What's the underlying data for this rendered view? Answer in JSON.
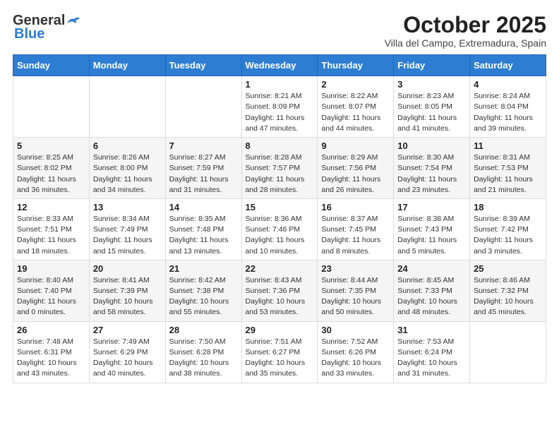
{
  "header": {
    "logo_general": "General",
    "logo_blue": "Blue",
    "month_title": "October 2025",
    "location": "Villa del Campo, Extremadura, Spain"
  },
  "weekdays": [
    "Sunday",
    "Monday",
    "Tuesday",
    "Wednesday",
    "Thursday",
    "Friday",
    "Saturday"
  ],
  "weeks": [
    [
      {
        "day": "",
        "info": ""
      },
      {
        "day": "",
        "info": ""
      },
      {
        "day": "",
        "info": ""
      },
      {
        "day": "1",
        "info": "Sunrise: 8:21 AM\nSunset: 8:09 PM\nDaylight: 11 hours\nand 47 minutes."
      },
      {
        "day": "2",
        "info": "Sunrise: 8:22 AM\nSunset: 8:07 PM\nDaylight: 11 hours\nand 44 minutes."
      },
      {
        "day": "3",
        "info": "Sunrise: 8:23 AM\nSunset: 8:05 PM\nDaylight: 11 hours\nand 41 minutes."
      },
      {
        "day": "4",
        "info": "Sunrise: 8:24 AM\nSunset: 8:04 PM\nDaylight: 11 hours\nand 39 minutes."
      }
    ],
    [
      {
        "day": "5",
        "info": "Sunrise: 8:25 AM\nSunset: 8:02 PM\nDaylight: 11 hours\nand 36 minutes."
      },
      {
        "day": "6",
        "info": "Sunrise: 8:26 AM\nSunset: 8:00 PM\nDaylight: 11 hours\nand 34 minutes."
      },
      {
        "day": "7",
        "info": "Sunrise: 8:27 AM\nSunset: 7:59 PM\nDaylight: 11 hours\nand 31 minutes."
      },
      {
        "day": "8",
        "info": "Sunrise: 8:28 AM\nSunset: 7:57 PM\nDaylight: 11 hours\nand 28 minutes."
      },
      {
        "day": "9",
        "info": "Sunrise: 8:29 AM\nSunset: 7:56 PM\nDaylight: 11 hours\nand 26 minutes."
      },
      {
        "day": "10",
        "info": "Sunrise: 8:30 AM\nSunset: 7:54 PM\nDaylight: 11 hours\nand 23 minutes."
      },
      {
        "day": "11",
        "info": "Sunrise: 8:31 AM\nSunset: 7:53 PM\nDaylight: 11 hours\nand 21 minutes."
      }
    ],
    [
      {
        "day": "12",
        "info": "Sunrise: 8:33 AM\nSunset: 7:51 PM\nDaylight: 11 hours\nand 18 minutes."
      },
      {
        "day": "13",
        "info": "Sunrise: 8:34 AM\nSunset: 7:49 PM\nDaylight: 11 hours\nand 15 minutes."
      },
      {
        "day": "14",
        "info": "Sunrise: 8:35 AM\nSunset: 7:48 PM\nDaylight: 11 hours\nand 13 minutes."
      },
      {
        "day": "15",
        "info": "Sunrise: 8:36 AM\nSunset: 7:46 PM\nDaylight: 11 hours\nand 10 minutes."
      },
      {
        "day": "16",
        "info": "Sunrise: 8:37 AM\nSunset: 7:45 PM\nDaylight: 11 hours\nand 8 minutes."
      },
      {
        "day": "17",
        "info": "Sunrise: 8:38 AM\nSunset: 7:43 PM\nDaylight: 11 hours\nand 5 minutes."
      },
      {
        "day": "18",
        "info": "Sunrise: 8:39 AM\nSunset: 7:42 PM\nDaylight: 11 hours\nand 3 minutes."
      }
    ],
    [
      {
        "day": "19",
        "info": "Sunrise: 8:40 AM\nSunset: 7:40 PM\nDaylight: 11 hours\nand 0 minutes."
      },
      {
        "day": "20",
        "info": "Sunrise: 8:41 AM\nSunset: 7:39 PM\nDaylight: 10 hours\nand 58 minutes."
      },
      {
        "day": "21",
        "info": "Sunrise: 8:42 AM\nSunset: 7:38 PM\nDaylight: 10 hours\nand 55 minutes."
      },
      {
        "day": "22",
        "info": "Sunrise: 8:43 AM\nSunset: 7:36 PM\nDaylight: 10 hours\nand 53 minutes."
      },
      {
        "day": "23",
        "info": "Sunrise: 8:44 AM\nSunset: 7:35 PM\nDaylight: 10 hours\nand 50 minutes."
      },
      {
        "day": "24",
        "info": "Sunrise: 8:45 AM\nSunset: 7:33 PM\nDaylight: 10 hours\nand 48 minutes."
      },
      {
        "day": "25",
        "info": "Sunrise: 8:46 AM\nSunset: 7:32 PM\nDaylight: 10 hours\nand 45 minutes."
      }
    ],
    [
      {
        "day": "26",
        "info": "Sunrise: 7:48 AM\nSunset: 6:31 PM\nDaylight: 10 hours\nand 43 minutes."
      },
      {
        "day": "27",
        "info": "Sunrise: 7:49 AM\nSunset: 6:29 PM\nDaylight: 10 hours\nand 40 minutes."
      },
      {
        "day": "28",
        "info": "Sunrise: 7:50 AM\nSunset: 6:28 PM\nDaylight: 10 hours\nand 38 minutes."
      },
      {
        "day": "29",
        "info": "Sunrise: 7:51 AM\nSunset: 6:27 PM\nDaylight: 10 hours\nand 35 minutes."
      },
      {
        "day": "30",
        "info": "Sunrise: 7:52 AM\nSunset: 6:26 PM\nDaylight: 10 hours\nand 33 minutes."
      },
      {
        "day": "31",
        "info": "Sunrise: 7:53 AM\nSunset: 6:24 PM\nDaylight: 10 hours\nand 31 minutes."
      },
      {
        "day": "",
        "info": ""
      }
    ]
  ]
}
